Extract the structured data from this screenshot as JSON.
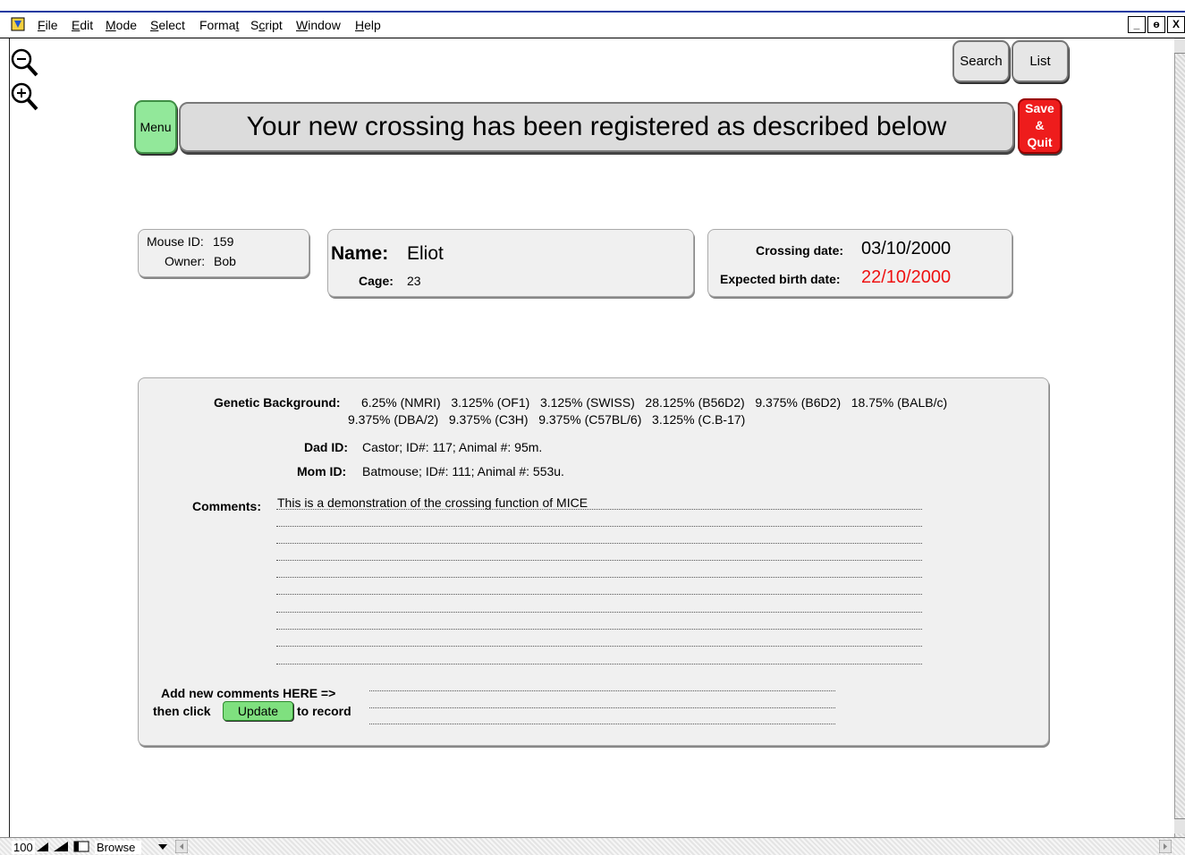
{
  "menubar": {
    "items": [
      {
        "label": "File",
        "u": "F"
      },
      {
        "label": "Edit",
        "u": "E"
      },
      {
        "label": "Mode",
        "u": "M"
      },
      {
        "label": "Select",
        "u": "S"
      },
      {
        "label": "Format",
        "u": "t"
      },
      {
        "label": "Script",
        "u": "c"
      },
      {
        "label": "Window",
        "u": "W"
      },
      {
        "label": "Help",
        "u": "H"
      }
    ],
    "window_controls": [
      "_",
      "ɵ",
      "X"
    ]
  },
  "toolbar": {
    "search_label": "Search",
    "list_label": "List",
    "menu_label": "Menu",
    "save_lines": [
      "Save",
      "&",
      "Quit"
    ]
  },
  "banner": {
    "text": "Your new crossing has been registered as described below"
  },
  "mouse": {
    "id_label": "Mouse ID:",
    "id_value": "159",
    "owner_label": "Owner:",
    "owner_value": "Bob",
    "name_label": "Name:",
    "name_value": "Eliot",
    "cage_label": "Cage:",
    "cage_value": "23"
  },
  "dates": {
    "crossing_label": "Crossing date:",
    "crossing_value": "03/10/2000",
    "birth_label": "Expected birth date:",
    "birth_value": "22/10/2000",
    "birth_color": "#ee1111"
  },
  "details": {
    "genetic_label": "Genetic Background:",
    "genetic_line1": "6.25% (NMRI)   3.125% (OF1)   3.125% (SWISS)   28.125% (B56D2)   9.375% (B6D2)   18.75% (BALB/c)",
    "genetic_line2": "9.375% (DBA/2)   9.375% (C3H)   9.375% (C57BL/6)   3.125% (C.B-17)",
    "dad_label": "Dad ID:",
    "dad_value": "Castor; ID#: 117; Animal #: 95m.",
    "mom_label": "Mom ID:",
    "mom_value": "Batmouse; ID#: 111; Animal #: 553u.",
    "comments_label": "Comments:",
    "comments_value": "This is a demonstration of the crossing function of MICE",
    "add_line1": "Add new comments HERE =>",
    "add_line2_a": "then click",
    "update_label": "Update",
    "add_line2_b": "to record"
  },
  "statusbar": {
    "zoom": "100",
    "mode": "Browse"
  }
}
